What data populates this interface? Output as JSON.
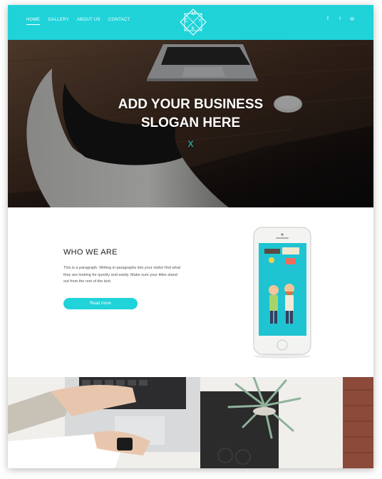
{
  "nav": {
    "items": [
      {
        "label": "HOME",
        "active": true
      },
      {
        "label": "GALLERY",
        "active": false
      },
      {
        "label": "ABOUT US",
        "active": false
      },
      {
        "label": "CONTACT",
        "active": false
      }
    ]
  },
  "logo": {
    "letters": [
      "M",
      "C",
      "Y",
      "K"
    ]
  },
  "social": [
    {
      "icon": "facebook-icon",
      "glyph": "f"
    },
    {
      "icon": "twitter-icon",
      "glyph": "t"
    },
    {
      "icon": "mail-icon",
      "glyph": "✉"
    }
  ],
  "hero": {
    "headline_line1": "ADD YOUR BUSINESS",
    "headline_line2": "SLOGAN HERE",
    "scroll_glyph": "X"
  },
  "who": {
    "title": "WHO WE ARE",
    "paragraph": "This is a paragraph. Writing in paragraphs lets your visitor find what they are looking for quickly and easily. Make sure your titles stand out from the rest of the text.",
    "button_label": "Read more"
  },
  "colors": {
    "accent": "#1fd3d9"
  }
}
